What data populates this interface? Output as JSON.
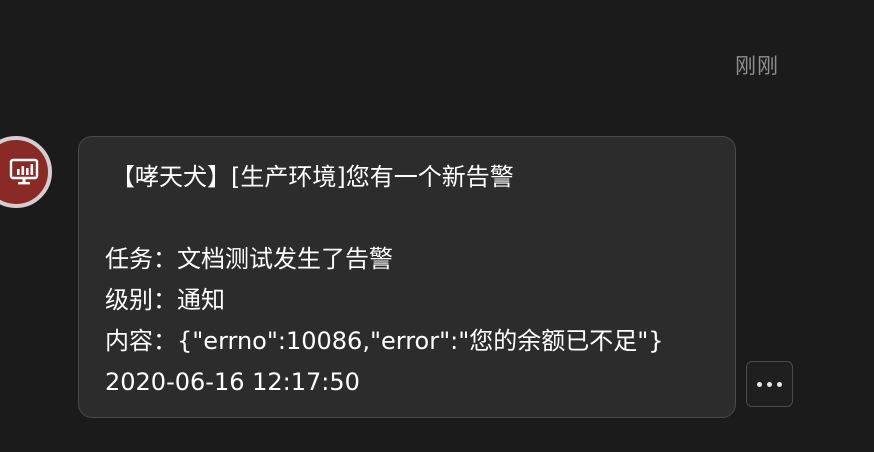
{
  "message": {
    "time": "刚刚",
    "lines": {
      "title": "【哮天犬】[生产环境]您有一个新告警",
      "task": "任务：文档测试发生了告警",
      "level": "级别：通知",
      "content": "内容：{\"errno\":10086,\"error\":\"您的余额已不足\"}",
      "datetime": "2020-06-16 12:17:50"
    }
  },
  "avatar": {
    "icon": "monitor-chart-icon",
    "color": "#8a2a26"
  },
  "actions": {
    "more_icon": "more-horizontal-icon"
  }
}
